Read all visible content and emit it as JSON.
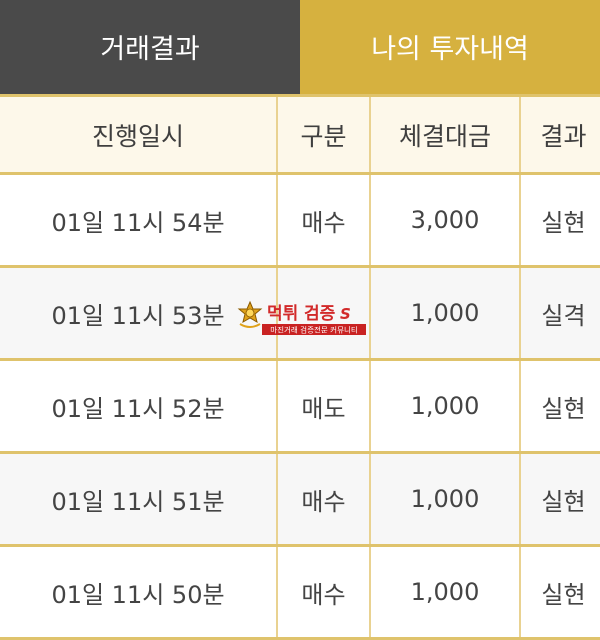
{
  "tabs": {
    "left_label": "거래결과",
    "right_label": "나의 투자내역"
  },
  "table": {
    "headers": [
      "진행일시",
      "구분",
      "체결대금",
      "결과"
    ],
    "rows": [
      {
        "time": "01일 11시 54분",
        "type": "매수",
        "amount": "3,000",
        "result": "실현"
      },
      {
        "time": "01일 11시 53분",
        "type": "",
        "amount": "1,000",
        "result": "실격"
      },
      {
        "time": "01일 11시 52분",
        "type": "매도",
        "amount": "1,000",
        "result": "실현"
      },
      {
        "time": "01일 11시 51분",
        "type": "매수",
        "amount": "1,000",
        "result": "실현"
      },
      {
        "time": "01일 11시 50분",
        "type": "매수",
        "amount": "1,000",
        "result": "실현"
      }
    ]
  },
  "watermark": {
    "title": "먹튀검증 사이트",
    "subtitle": "마진거래 검증전문 커뮤니티"
  },
  "colors": {
    "tab_left_bg": "#4a4a4a",
    "tab_right_bg": "#d6b13f",
    "header_bg": "#fdf8ea",
    "border": "#dfc36c",
    "red": "#c9363f",
    "blue": "#2e9dc9"
  }
}
